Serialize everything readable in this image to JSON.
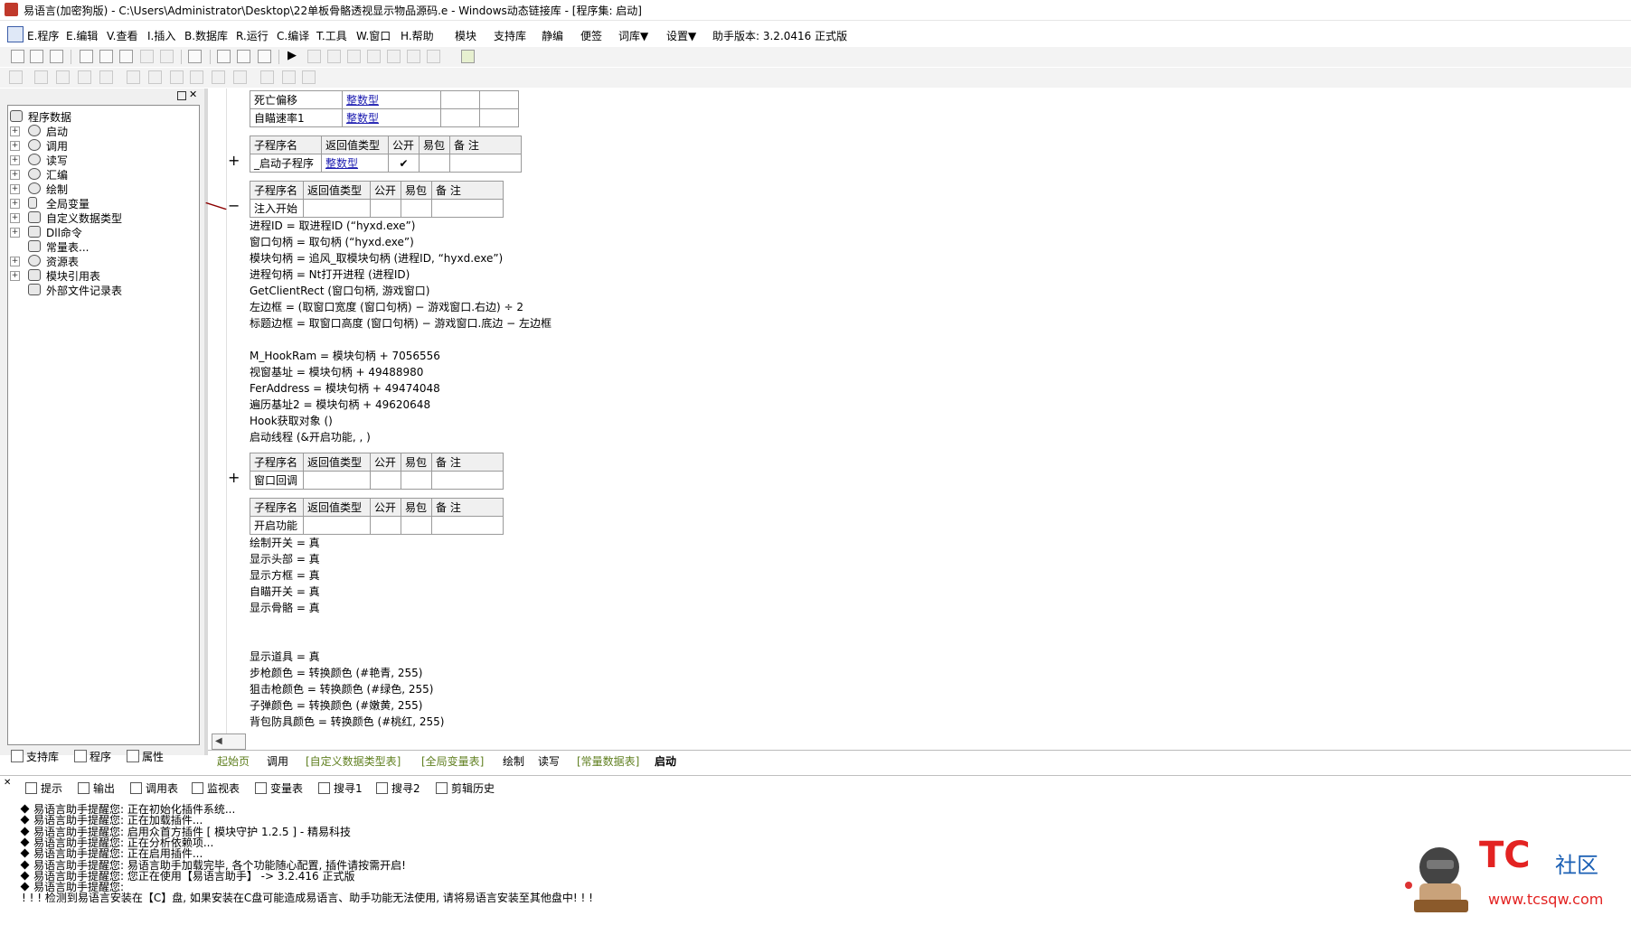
{
  "window": {
    "title": "易语言(加密狗版) - C:\\Users\\Administrator\\Desktop\\22单板骨骼透视显示物品源码.e - Windows动态链接库 - [程序集: 启动]"
  },
  "menu": {
    "items": [
      "E.程序",
      "E.编辑",
      "V.查看",
      "I.插入",
      "B.数据库",
      "R.运行",
      "C.编译",
      "T.工具",
      "W.窗口",
      "H.帮助",
      "模块",
      "支持库",
      "静编",
      "便签",
      "词库▼",
      "设置▼",
      "助手版本: 3.2.0416 正式版"
    ]
  },
  "left_panel": {
    "tree": [
      {
        "label": "程序数据"
      },
      {
        "label": "启动"
      },
      {
        "label": "调用"
      },
      {
        "label": "读写"
      },
      {
        "label": "汇编"
      },
      {
        "label": "绘制"
      },
      {
        "label": "全局变量"
      },
      {
        "label": "自定义数据类型"
      },
      {
        "label": "Dll命令"
      },
      {
        "label": "常量表..."
      },
      {
        "label": "资源表"
      },
      {
        "label": "模块引用表"
      },
      {
        "label": "外部文件记录表"
      }
    ],
    "tabs": [
      "支持库",
      "程序",
      "属性"
    ]
  },
  "editor": {
    "var_table": [
      {
        "name": "死亡偏移",
        "type": "整数型"
      },
      {
        "name": "自瞄速率1",
        "type": "整数型"
      }
    ],
    "sub_header": {
      "name": "子程序名",
      "ret": "返回值类型",
      "public": "公开",
      "pack": "易包",
      "note": "备 注"
    },
    "sub1": {
      "name": "_启动子程序",
      "ret": "整数型",
      "check": "✔"
    },
    "sub2": {
      "name": "注入开始"
    },
    "code_block1": [
      "进程ID = 取进程ID (“hyxd.exe”)",
      "窗口句柄 = 取句柄 (“hyxd.exe”)",
      "模块句柄 = 追风_取模块句柄 (进程ID, “hyxd.exe”)",
      "进程句柄 = Nt打开进程 (进程ID)",
      "GetClientRect (窗口句柄, 游戏窗口)",
      "左边框 = (取窗口宽度 (窗口句柄) − 游戏窗口.右边) ÷ 2",
      "标题边框 = 取窗口高度 (窗口句柄) − 游戏窗口.底边 − 左边框"
    ],
    "code_block2": [
      "M_HookRam = 模块句柄 + 7056556",
      "视窗基址 = 模块句柄 + 49488980",
      "FerAddress = 模块句柄 + 49474048",
      "遍历基址2 = 模块句柄 + 49620648",
      "Hook获取对象 ()",
      "启动线程 (&开启功能, , )"
    ],
    "sub3": {
      "name": "窗口回调"
    },
    "sub4": {
      "name": "开启功能"
    },
    "code_block3": [
      "绘制开关 = 真",
      "显示头部 = 真",
      "显示方框 = 真",
      "自瞄开关 = 真",
      "显示骨骼 = 真"
    ],
    "code_block4": [
      "显示道具 = 真",
      "步枪颜色 = 转换颜色 (#艳青, 255)",
      "狙击枪颜色 = 转换颜色 (#绿色, 255)",
      "子弹颜色 = 转换颜色 (#嫩黄, 255)",
      "背包防具颜色 = 转换颜色 (#桃红, 255)"
    ]
  },
  "editor_tabs": [
    "起始页",
    "调用",
    "[自定义数据类型表]",
    "[全局变量表]",
    "绘制",
    "读写",
    "[常量数据表]",
    "启动"
  ],
  "bottom_tabs": [
    "提示",
    "输出",
    "调用表",
    "监视表",
    "变量表",
    "搜寻1",
    "搜寻2",
    "剪辑历史"
  ],
  "output_lines": [
    "易语言助手提醒您: 正在初始化插件系统...",
    "易语言助手提醒您: 正在加载插件...",
    "易语言助手提醒您: 启用众首方插件 [ 模块守护 1.2.5 ] - 精易科技",
    "易语言助手提醒您: 正在分析依赖项...",
    "易语言助手提醒您: 正在启用插件...",
    "易语言助手提醒您: 易语言助手加载完毕, 各个功能随心配置, 插件请按需开启!",
    "易语言助手提醒您: 您正在使用【易语言助手】 -> 3.2.416 正式版",
    "易语言助手提醒您:",
    "! ! ! 检测到易语言安装在【C】盘, 如果安装在C盘可能造成易语言、助手功能无法使用, 请将易语言安装至其他盘中! ! !"
  ],
  "watermark": {
    "brand": "TC",
    "suffix": "社区",
    "url": "www.tcsqw.com"
  }
}
